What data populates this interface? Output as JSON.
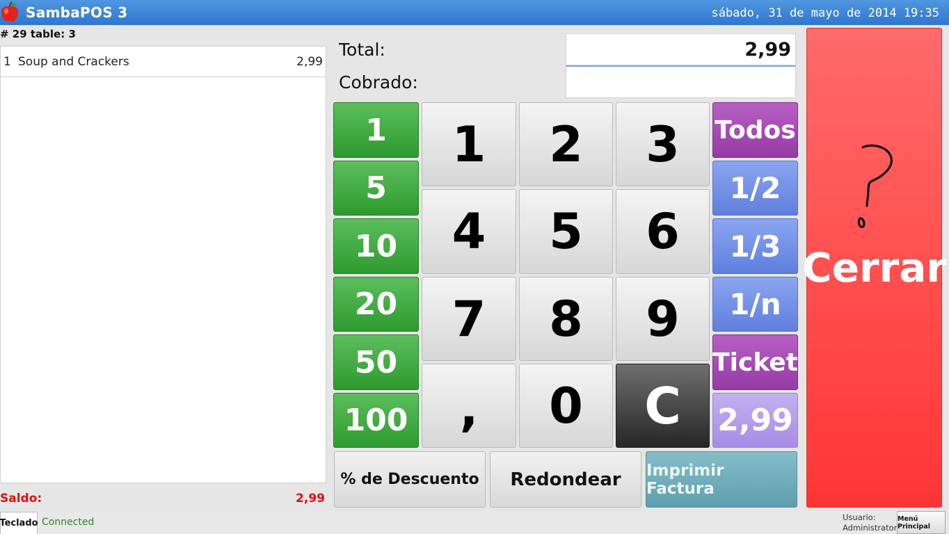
{
  "app": {
    "title": "SambaPOS 3",
    "datetime": "sábado, 31 de mayo de 2014 19:35"
  },
  "ticket": {
    "header": "# 29 table: 3",
    "orders": [
      {
        "qty": "1",
        "name": "Soup and Crackers",
        "price": "2,99"
      }
    ],
    "saldo_label": "Saldo:",
    "saldo_value": "2,99"
  },
  "payment": {
    "total_label": "Total:",
    "total_value": "2,99",
    "cobrado_label": "Cobrado:",
    "cobrado_value": ""
  },
  "quick_amounts": [
    "1",
    "5",
    "10",
    "20",
    "50",
    "100"
  ],
  "keypad": {
    "keys": [
      "1",
      "2",
      "3",
      "4",
      "5",
      "6",
      "7",
      "8",
      "9",
      ",",
      "0"
    ],
    "clear": "C"
  },
  "splits": {
    "todos": "Todos",
    "half": "1/2",
    "third": "1/3",
    "n": "1/n",
    "ticket": "Ticket",
    "remaining": "2,99"
  },
  "actions": {
    "descuento": "% de Descuento",
    "redondear": "Redondear",
    "imprimir": "Imprimir Factura"
  },
  "cerrar": "Cerrar",
  "status": {
    "teclado": "Teclado",
    "connection": "Connected",
    "usuario_label": "Usuario:",
    "usuario_name": "Administrator",
    "menu": "Menú Principal"
  },
  "colors": {
    "titlebar": "#2f76cf",
    "saldo": "#e01010",
    "cerrar": "#ff3535",
    "connected": "#2a8a2a"
  },
  "icons": {
    "app": "apple-icon",
    "cerrar_doodle": "question-mark-icon"
  }
}
